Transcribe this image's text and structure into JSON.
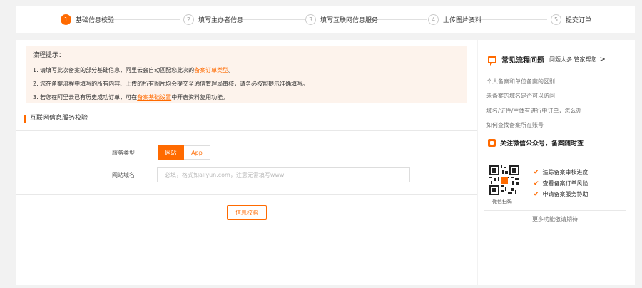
{
  "steps": [
    {
      "num": "1",
      "label": "基础信息校验"
    },
    {
      "num": "2",
      "label": "填写主办者信息"
    },
    {
      "num": "3",
      "label": "填写互联网信息服务"
    },
    {
      "num": "4",
      "label": "上传图片资料"
    },
    {
      "num": "5",
      "label": "提交订单"
    }
  ],
  "tips": {
    "title": "流程提示：",
    "line1_pre": "1. 请填写此次备案的部分基础信息，阿里云会自动匹配您此次的",
    "line1_link": "备案订单类型",
    "line1_post": "。",
    "line2": "2. 您在备案流程中填写的所有内容、上传的所有图片均会提交至通信管理局审核，请务必按照提示准确填写。",
    "line3_pre": "3. 若您在阿里云已有历史成功订单，可在",
    "line3_link": "备案基础设置",
    "line3_post": "中开启资料复用功能。"
  },
  "section_title": "互联网信息服务校验",
  "form": {
    "service_type_label": "服务类型",
    "service_options": [
      "网站",
      "App"
    ],
    "domain_label": "网站域名",
    "domain_placeholder": "必填，格式如aliyun.com，注意无需填写www",
    "submit_label": "信息校验"
  },
  "sidebar": {
    "faq_title": "常见流程问题",
    "faq_more": "问题太多 管家帮您",
    "faq_arrow": ">",
    "faq_items": [
      "个人备案和单位备案的区别",
      "未备案的域名是否可以访问",
      "域名/证件/主体有进行中订单，怎么办",
      "如何查找备案所在账号"
    ],
    "wechat_title": "关注微信公众号，备案随时查",
    "qr_label": "微信扫码",
    "check_mark": "✔",
    "features": [
      "追踪备案审核进度",
      "查看备案订单风险",
      "申请备案服务协助"
    ],
    "more_text": "更多功能敬请期待"
  },
  "colors": {
    "accent": "#ff6a00",
    "tips_bg": "#fdf3ec"
  }
}
